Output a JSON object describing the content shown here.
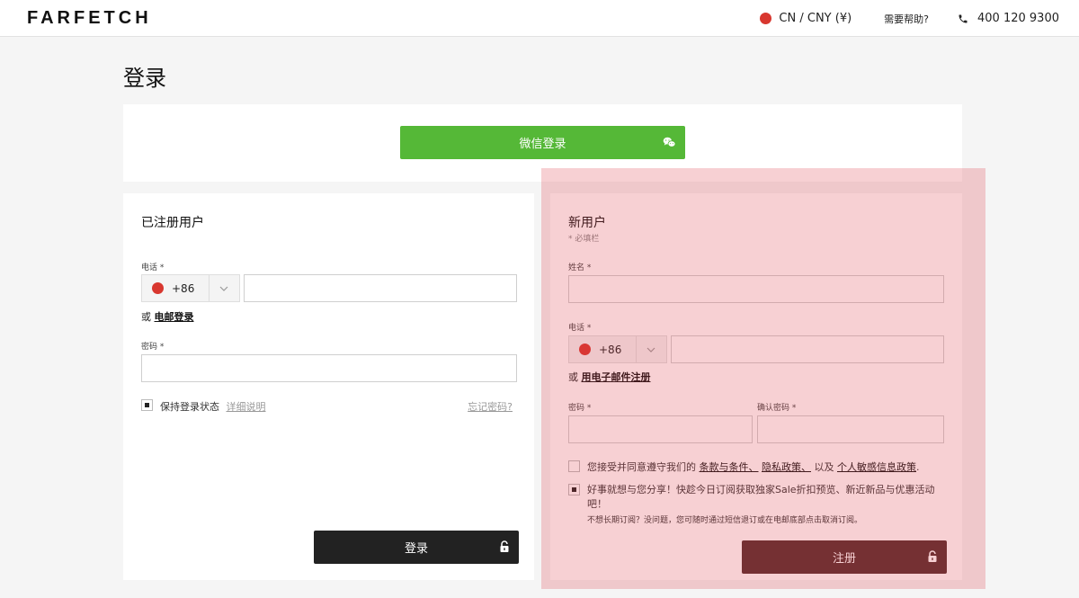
{
  "header": {
    "logo": "FARFETCH",
    "locale": "CN / CNY (¥)",
    "help": "需要帮助?",
    "phone": "400 120 9300"
  },
  "page_title": "登录",
  "wechat": {
    "label": "微信登录",
    "icon": "wechat-icon"
  },
  "login": {
    "title": "已注册用户",
    "phone_label": "电话 *",
    "country_code": "+86",
    "or_text": "或",
    "email_login": "电邮登录",
    "password_label": "密码 *",
    "remember": "保持登录状态",
    "details": "详细说明",
    "remember_checked": true,
    "forgot": "忘记密码?",
    "submit": "登录"
  },
  "register": {
    "title": "新用户",
    "required_note": "* 必填栏",
    "name_label": "姓名 *",
    "phone_label": "电话 *",
    "country_code": "+86",
    "or_text": "或",
    "email_register": "用电子邮件注册",
    "password_label": "密码 *",
    "confirm_label": "确认密码 *",
    "terms_prefix": "您接受并同意遵守我们的",
    "terms_link": "条款与条件、",
    "privacy_link": "隐私政策、",
    "terms_and": "以及",
    "sensitive_link": "个人敏感信息政策",
    "terms_suffix": ".",
    "terms_checked": false,
    "promo": "好事就想与您分享！快趁今日订阅获取独家Sale折扣预览、新近新品与优惠活动吧！",
    "promo_checked": true,
    "promo_sub": "不想长期订阅？没问题，您可随时通过短信退订或在电邮底部点击取消订阅。",
    "submit": "注册"
  },
  "colors": {
    "wechat_green": "#55b837",
    "button_dark": "#222222",
    "highlight": "#dc3c46"
  }
}
